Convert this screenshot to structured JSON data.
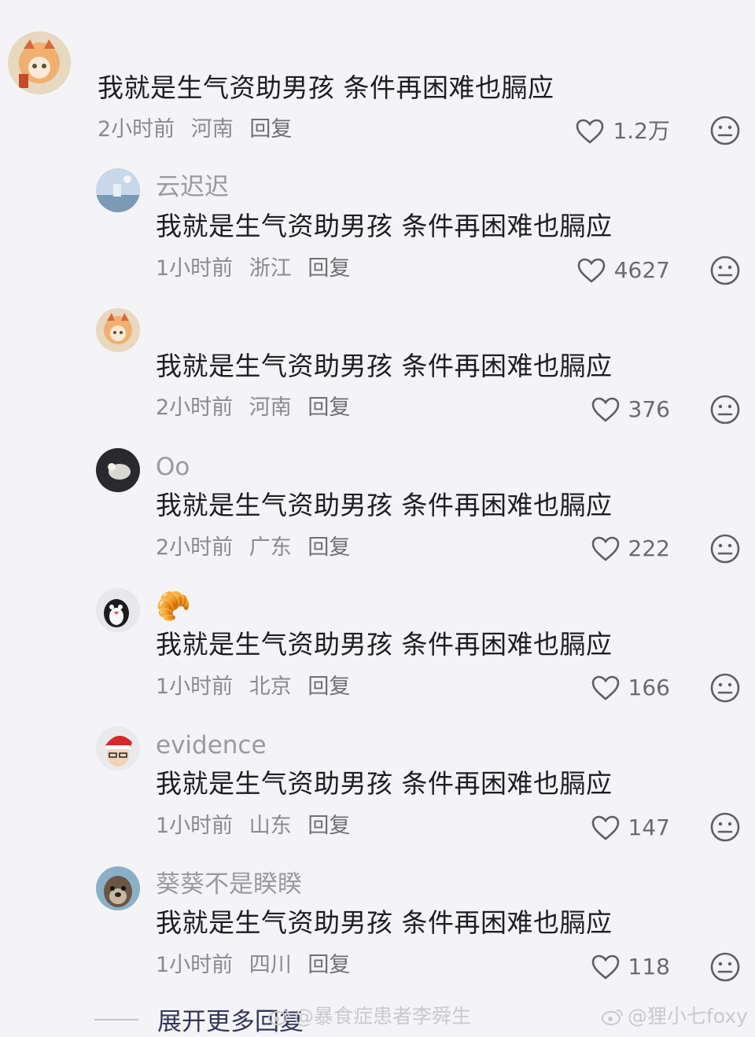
{
  "comments": [
    {
      "username": "",
      "content": "我就是生气资助男孩 条件再困难也膈应",
      "time": "2小时前",
      "location": "河南",
      "reply": "回复",
      "likes": "1.2万",
      "avatar": "anime-tiger-avatar"
    },
    {
      "username": "云迟迟",
      "content": "我就是生气资助男孩 条件再困难也膈应",
      "time": "1小时前",
      "location": "浙江",
      "reply": "回复",
      "likes": "4627",
      "avatar": "sky-landscape-avatar"
    },
    {
      "username": "",
      "content": "我就是生气资助男孩 条件再困难也膈应",
      "time": "2小时前",
      "location": "河南",
      "reply": "回复",
      "likes": "376",
      "avatar": "anime-tiger-avatar"
    },
    {
      "username": "Oo",
      "content": "我就是生气资助男孩 条件再困难也膈应",
      "time": "2小时前",
      "location": "广东",
      "reply": "回复",
      "likes": "222",
      "avatar": "dark-object-avatar"
    },
    {
      "username": "🥐",
      "content": "我就是生气资助男孩 条件再困难也膈应",
      "time": "1小时前",
      "location": "北京",
      "reply": "回复",
      "likes": "166",
      "avatar": "penguin-avatar"
    },
    {
      "username": "evidence",
      "content": "我就是生气资助男孩 条件再困难也膈应",
      "time": "1小时前",
      "location": "山东",
      "reply": "回复",
      "likes": "147",
      "avatar": "santa-hat-avatar"
    },
    {
      "username": "葵葵不是睽睽",
      "content": "我就是生气资助男孩 条件再困难也膈应",
      "time": "1小时前",
      "location": "四川",
      "reply": "回复",
      "likes": "118",
      "avatar": "otter-avatar"
    }
  ],
  "expand_label": "展开更多回复",
  "watermarks": [
    "@暴食症患者李舜生",
    "@狸小七foxy"
  ]
}
